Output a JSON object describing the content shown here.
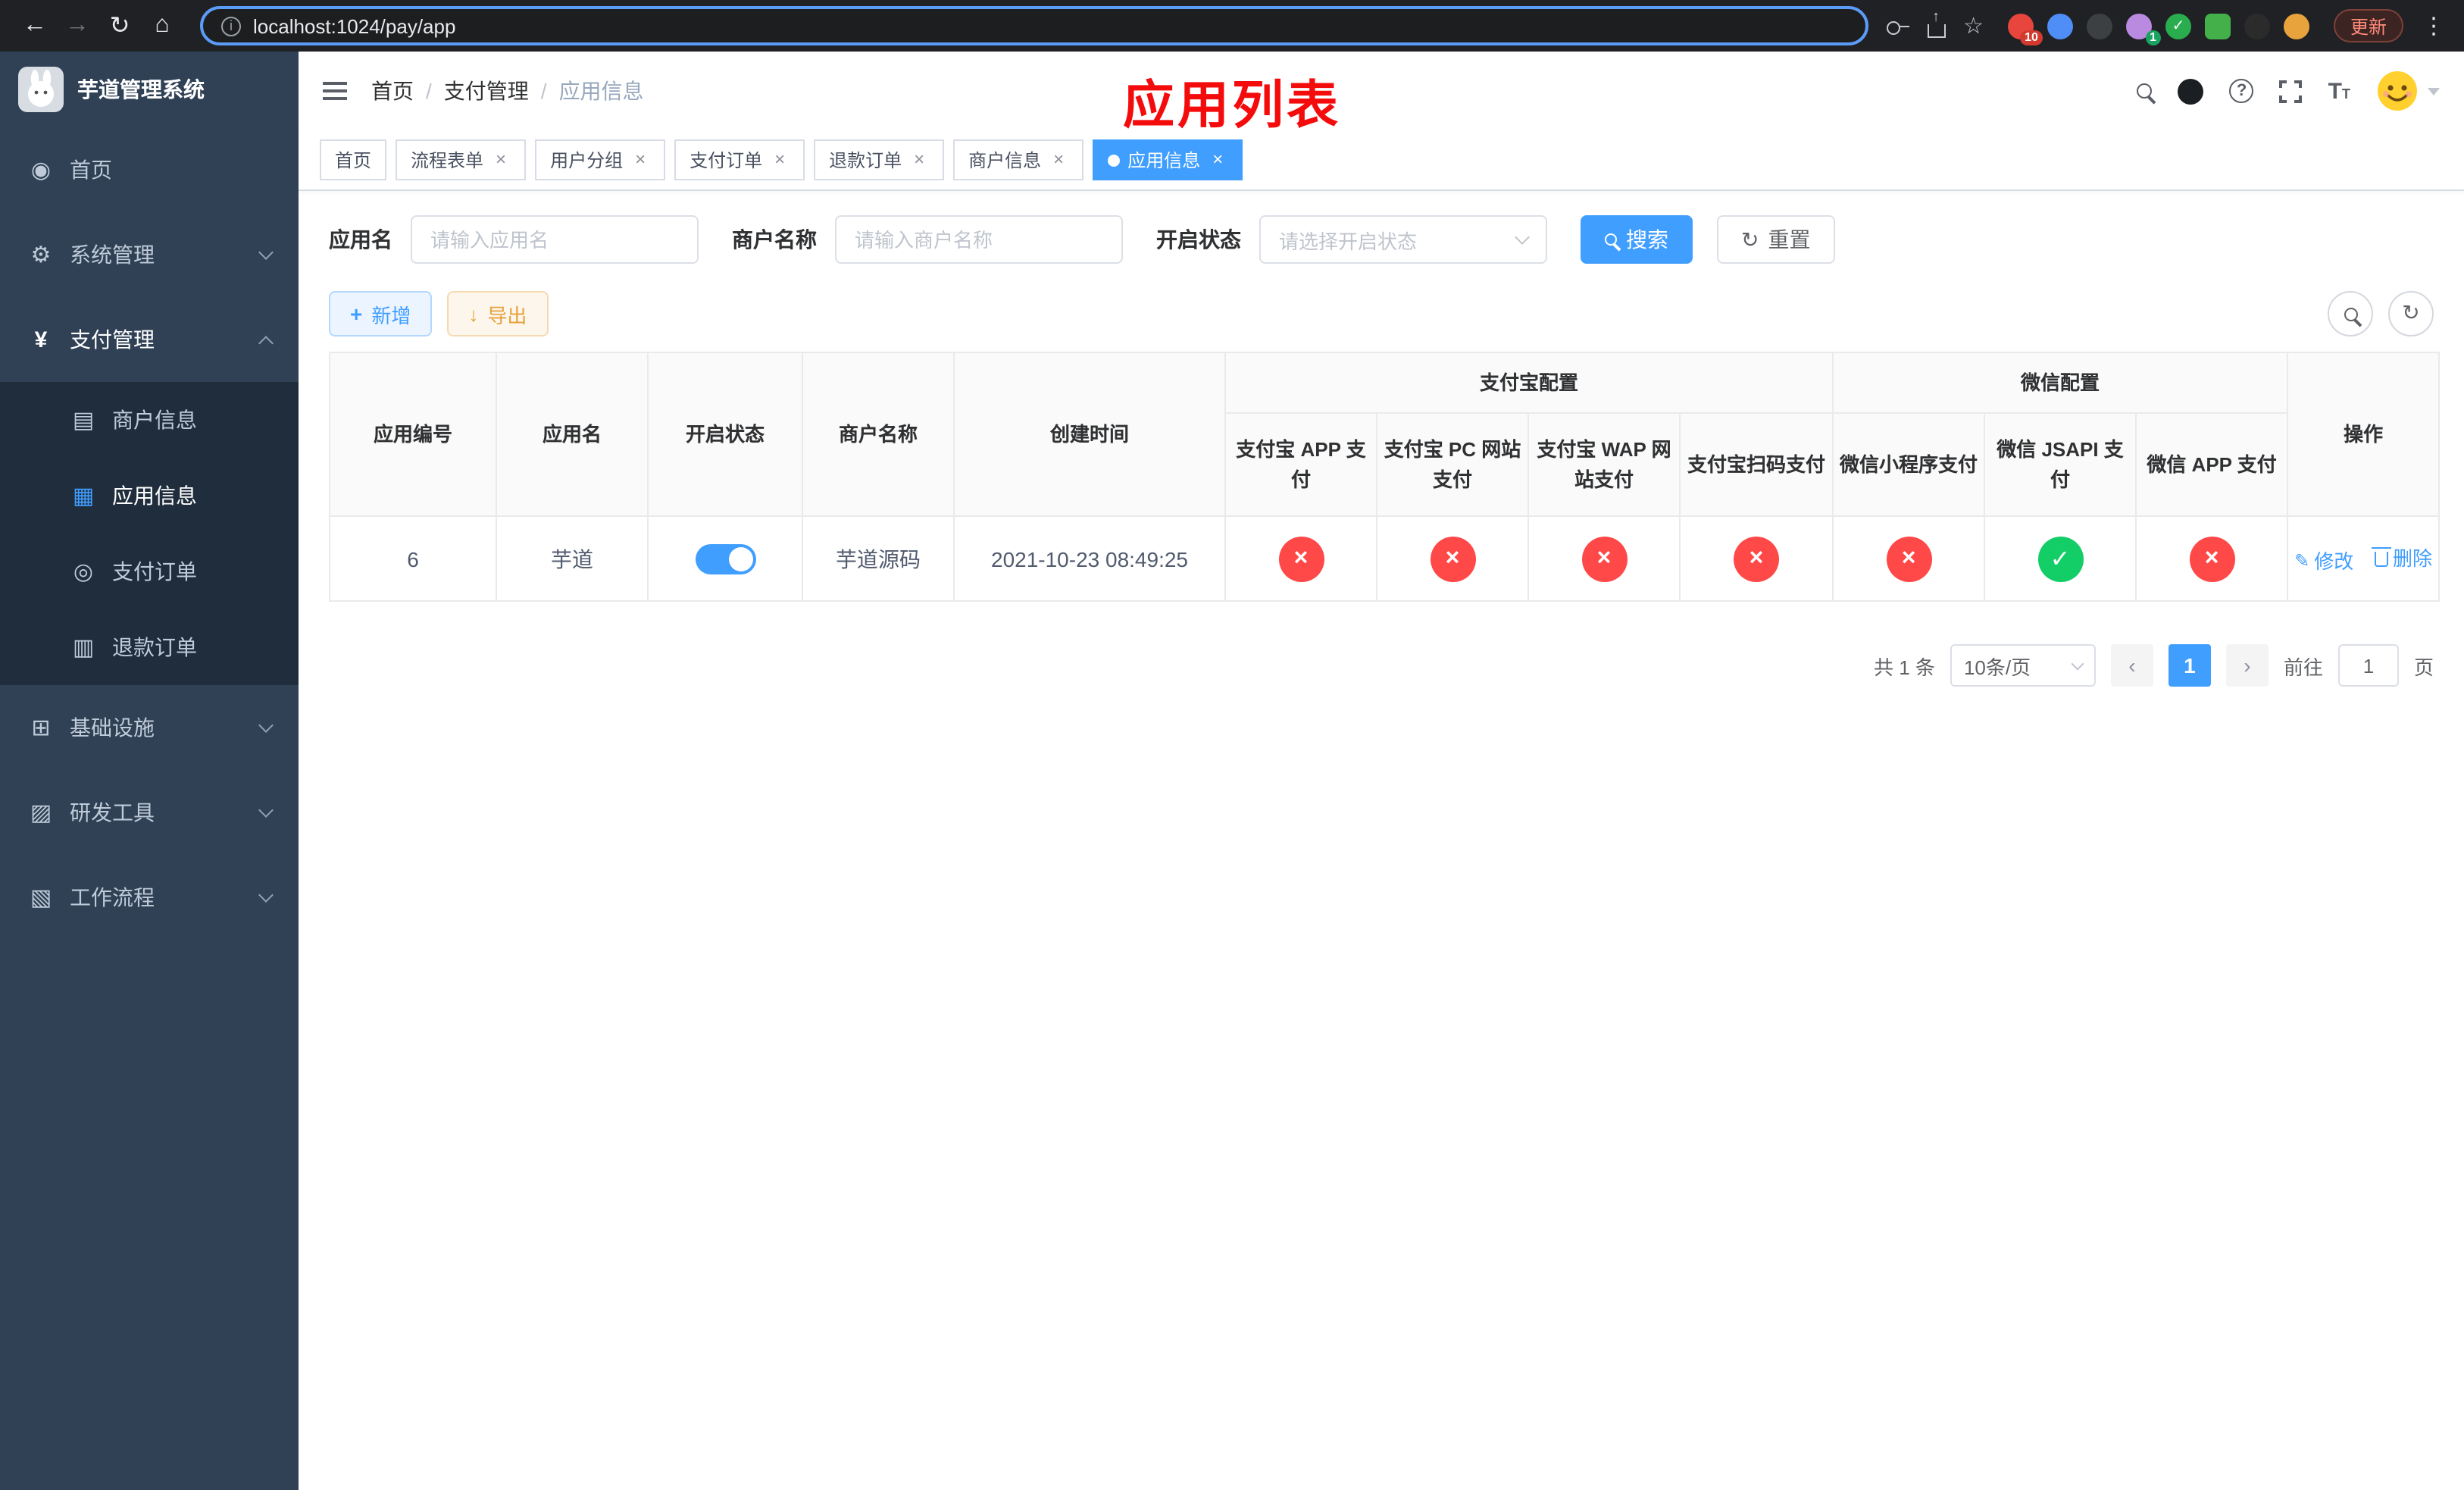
{
  "colors": {
    "accent_blue": "#409EFF",
    "danger_red": "#FF4949",
    "success_green": "#13CE66",
    "sidebar_bg": "#304156",
    "sidebar_submenu_bg": "#1F2D3D",
    "annotation_red": "#F40B0B"
  },
  "browser": {
    "url": "localhost:1024/pay/app",
    "update_button": "更新",
    "extension_badges": {
      "first": "10",
      "fourth": "1"
    }
  },
  "sidebar": {
    "app_title": "芋道管理系统",
    "menu": [
      {
        "label": "首页"
      },
      {
        "label": "系统管理"
      },
      {
        "label": "支付管理"
      },
      {
        "label": "基础设施"
      },
      {
        "label": "研发工具"
      },
      {
        "label": "工作流程"
      }
    ],
    "submenu": [
      {
        "label": "商户信息"
      },
      {
        "label": "应用信息"
      },
      {
        "label": "支付订单"
      },
      {
        "label": "退款订单"
      }
    ]
  },
  "navbar": {
    "breadcrumb": [
      "首页",
      "支付管理",
      "应用信息"
    ],
    "annotation": "应用列表"
  },
  "tabs": [
    {
      "label": "首页"
    },
    {
      "label": "流程表单"
    },
    {
      "label": "用户分组"
    },
    {
      "label": "支付订单"
    },
    {
      "label": "退款订单"
    },
    {
      "label": "商户信息"
    },
    {
      "label": "应用信息"
    }
  ],
  "filters": {
    "app_name_label": "应用名",
    "app_name_placeholder": "请输入应用名",
    "merchant_label": "商户名称",
    "merchant_placeholder": "请输入商户名称",
    "status_label": "开启状态",
    "status_placeholder": "请选择开启状态",
    "search_button": "搜索",
    "reset_button": "重置"
  },
  "toolbar": {
    "add_button": "新增",
    "export_button": "导出"
  },
  "table": {
    "group_headers": {
      "alipay": "支付宝配置",
      "wechat": "微信配置"
    },
    "columns": {
      "app_id": "应用编号",
      "app_name": "应用名",
      "status": "开启状态",
      "merchant": "商户名称",
      "created": "创建时间",
      "alipay_app": "支付宝 APP 支付",
      "alipay_pc": "支付宝 PC 网站支付",
      "alipay_wap": "支付宝 WAP 网站支付",
      "alipay_qr": "支付宝扫码支付",
      "wx_mini": "微信小程序支付",
      "wx_jsapi": "微信 JSAPI 支付",
      "wx_app": "微信 APP 支付",
      "action": "操作"
    },
    "row": {
      "app_id": "6",
      "app_name": "芋道",
      "status_enabled": true,
      "merchant": "芋道源码",
      "created": "2021-10-23 08:49:25",
      "pay_statuses": [
        "x",
        "x",
        "x",
        "x",
        "x",
        "ok",
        "x"
      ],
      "edit_link": "修改",
      "delete_link": "删除"
    }
  },
  "pagination": {
    "total_text": "共 1 条",
    "page_size_text": "10条/页",
    "current_page": "1",
    "goto_label": "前往",
    "goto_value": "1",
    "goto_suffix": "页"
  }
}
